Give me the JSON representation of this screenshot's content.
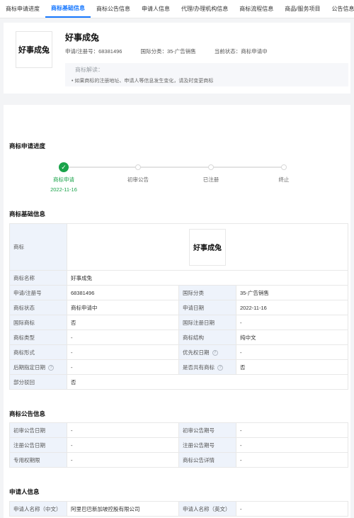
{
  "tabs": [
    {
      "label": "商标申请进度"
    },
    {
      "label": "商标基础信息"
    },
    {
      "label": "商标公告信息"
    },
    {
      "label": "申请人信息"
    },
    {
      "label": "代理/办理机构信息"
    },
    {
      "label": "商标流程信息"
    },
    {
      "label": "商品/服务项目"
    },
    {
      "label": "公告信息"
    }
  ],
  "header": {
    "logo_text": "好事成兔",
    "title": "好事成兔",
    "reg_no": "申请/注册号：68381496",
    "intl_class": "国际分类：35-广告销售",
    "status": "当前状态：商标申请中",
    "explain_title": "商标解读：",
    "explain_line": "• 如果商标的注册地址、申请人等信息发生变化，请及时变更商标"
  },
  "progress": {
    "title": "商标申请进度",
    "steps": [
      {
        "label": "商标申请",
        "date": "2022-11-16"
      },
      {
        "label": "初审公告",
        "date": ""
      },
      {
        "label": "已注册",
        "date": ""
      },
      {
        "label": "终止",
        "date": ""
      }
    ]
  },
  "basic": {
    "title": "商标基础信息",
    "mark_label": "商标",
    "mark_image_text": "好事成兔",
    "name_label": "商标名称",
    "name_value": "好事成兔",
    "rows": [
      {
        "l1": "申请/注册号",
        "v1": "68381496",
        "l2": "国际分类",
        "v2": "35-广告销售"
      },
      {
        "l1": "商标状态",
        "v1": "商标申请中",
        "l2": "申请日期",
        "v2": "2022-11-16"
      },
      {
        "l1": "国际商标",
        "v1": "否",
        "l2": "国际注册日期",
        "v2": "-"
      },
      {
        "l1": "商标类型",
        "v1": "-",
        "l2": "商标结构",
        "v2": "纯中文"
      },
      {
        "l1": "商标形式",
        "v1": "-",
        "l2": "优先权日期",
        "v2": "-"
      },
      {
        "l1": "后期指定日期",
        "v1": "-",
        "l2": "是否共有商标",
        "v2": "否"
      }
    ],
    "partial_label": "部分驳回",
    "partial_value": "否"
  },
  "announce": {
    "title": "商标公告信息",
    "rows": [
      {
        "l1": "初审公告日期",
        "v1": "-",
        "l2": "初审公告期号",
        "v2": "-"
      },
      {
        "l1": "注册公告日期",
        "v1": "-",
        "l2": "注册公告期号",
        "v2": "-"
      },
      {
        "l1": "专用权期限",
        "v1": "-",
        "l2": "商标公告详情",
        "v2": "-"
      }
    ]
  },
  "applicant": {
    "title": "申请人信息",
    "rows": [
      {
        "l1": "申请人名称（中文）",
        "v1": "阿里巴巴新加坡控股有限公司",
        "l2": "申请人名称（英文）",
        "v2": "-"
      }
    ]
  },
  "colors": {
    "accent": "#1677ff",
    "success": "#1aa34a",
    "label_bg": "#eef3fb"
  }
}
